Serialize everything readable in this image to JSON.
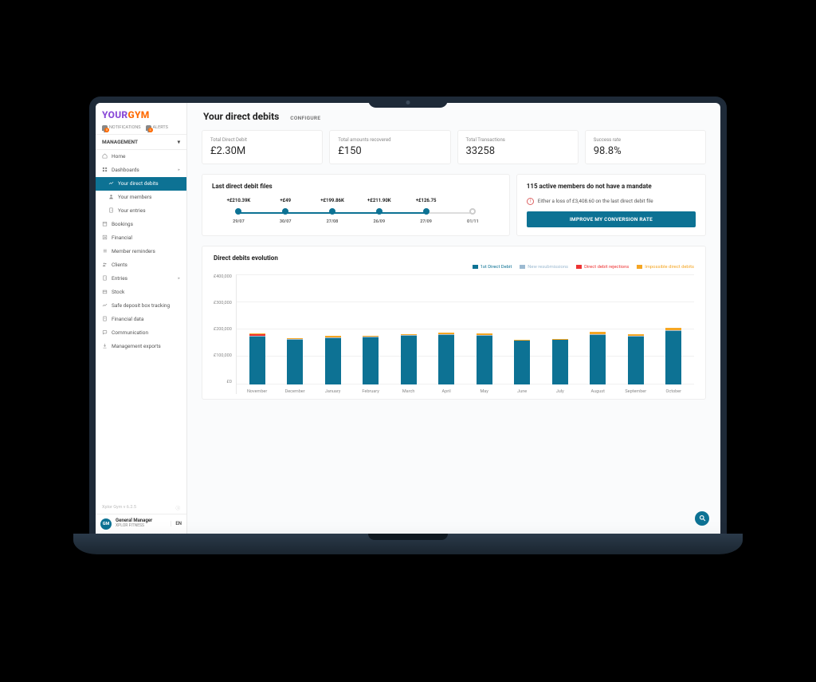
{
  "logo": {
    "part1": "YOUR",
    "part2": "GYM"
  },
  "notifications": {
    "label": "NOTIFICATIONS",
    "badge": "5"
  },
  "alerts": {
    "label": "ALERTS",
    "badge": "3"
  },
  "section_header": "MANAGEMENT",
  "nav": [
    {
      "key": "home",
      "label": "Home",
      "icon": "home-icon"
    },
    {
      "key": "dashboards",
      "label": "Dashboards",
      "icon": "grid-icon",
      "caret": true
    },
    {
      "key": "direct-debits",
      "label": "Your direct debits",
      "icon": "line-chart-icon",
      "sub": true,
      "active": true
    },
    {
      "key": "members",
      "label": "Your members",
      "icon": "user-icon",
      "sub": true
    },
    {
      "key": "entries",
      "label": "Your entries",
      "icon": "door-icon",
      "sub": true
    },
    {
      "key": "bookings",
      "label": "Bookings",
      "icon": "calendar-icon"
    },
    {
      "key": "financial",
      "label": "Financial",
      "icon": "finance-icon"
    },
    {
      "key": "reminders",
      "label": "Member reminders",
      "icon": "list-icon"
    },
    {
      "key": "clients",
      "label": "Clients",
      "icon": "users-icon"
    },
    {
      "key": "entries2",
      "label": "Entries",
      "icon": "door-icon",
      "caret": true
    },
    {
      "key": "stock",
      "label": "Stock",
      "icon": "box-icon"
    },
    {
      "key": "safebox",
      "label": "Safe deposit box tracking",
      "icon": "line-chart-icon"
    },
    {
      "key": "findata",
      "label": "Financial data",
      "icon": "doc-icon"
    },
    {
      "key": "comm",
      "label": "Communication",
      "icon": "chat-icon"
    },
    {
      "key": "exports",
      "label": "Management exports",
      "icon": "download-icon"
    }
  ],
  "version": "Xplor Gym v 6.2.5",
  "user": {
    "initials": "GM",
    "name": "General Manager",
    "org": "XPLOR FITNESS"
  },
  "lang": "EN",
  "page_title": "Your direct debits",
  "configure": "CONFIGURE",
  "kpis": [
    {
      "label": "Total Direct Debit",
      "value": "£2.30M"
    },
    {
      "label": "Total amounts recovered",
      "value": "£150"
    },
    {
      "label": "Total Transactions",
      "value": "33258"
    },
    {
      "label": "Success rate",
      "value": "98.8%"
    }
  ],
  "files_card": {
    "title": "Last direct debit files",
    "items": [
      {
        "amount": "+£210.39K",
        "date": "29/07",
        "filled": true
      },
      {
        "amount": "+£49",
        "date": "30/07",
        "filled": true
      },
      {
        "amount": "+£199.86K",
        "date": "27/08",
        "filled": true
      },
      {
        "amount": "+£211.90K",
        "date": "26/09",
        "filled": true
      },
      {
        "amount": "+£126.75",
        "date": "27/09",
        "filled": true
      },
      {
        "amount": "",
        "date": "01/11",
        "filled": false
      }
    ]
  },
  "mandate_card": {
    "title": "115 active members do not have a mandate",
    "warn": "Either a loss of £3,408.60 on the last direct debit file",
    "cta": "IMPROVE MY CONVERSION RATE"
  },
  "chart_title": "Direct debits evolution",
  "legend": {
    "l1": "1st Direct Debit",
    "l2": "New resubmissions",
    "l3": "Direct debit rejections",
    "l4": "Impossible direct debits"
  },
  "chart_data": {
    "type": "bar",
    "categories": [
      "November",
      "December",
      "January",
      "February",
      "March",
      "April",
      "May",
      "June",
      "July",
      "August",
      "September",
      "October"
    ],
    "series": [
      {
        "name": "1st Direct Debit",
        "color": "#0d7294",
        "values": [
          188000,
          177000,
          183000,
          186000,
          192000,
          195000,
          193000,
          172000,
          175000,
          196000,
          190000,
          210000
        ]
      },
      {
        "name": "New resubmissions",
        "color": "#9cbad1",
        "values": [
          3000,
          2000,
          2000,
          2000,
          2000,
          2000,
          2000,
          1000,
          1000,
          3000,
          2000,
          3000
        ]
      },
      {
        "name": "Direct debit rejections",
        "color": "#e33",
        "values": [
          7000,
          0,
          0,
          0,
          0,
          0,
          0,
          0,
          0,
          0,
          0,
          0
        ]
      },
      {
        "name": "Impossible direct debits",
        "color": "#f5a623",
        "values": [
          5000,
          5000,
          6000,
          5000,
          6000,
          7000,
          6000,
          4000,
          4000,
          10000,
          6000,
          11000
        ]
      }
    ],
    "title": "Direct debits evolution",
    "xlabel": "",
    "ylabel": "",
    "ylim": [
      0,
      400000
    ],
    "yticks": [
      "£400,000",
      "£300,000",
      "£200,000",
      "£100,000",
      "£0"
    ]
  }
}
